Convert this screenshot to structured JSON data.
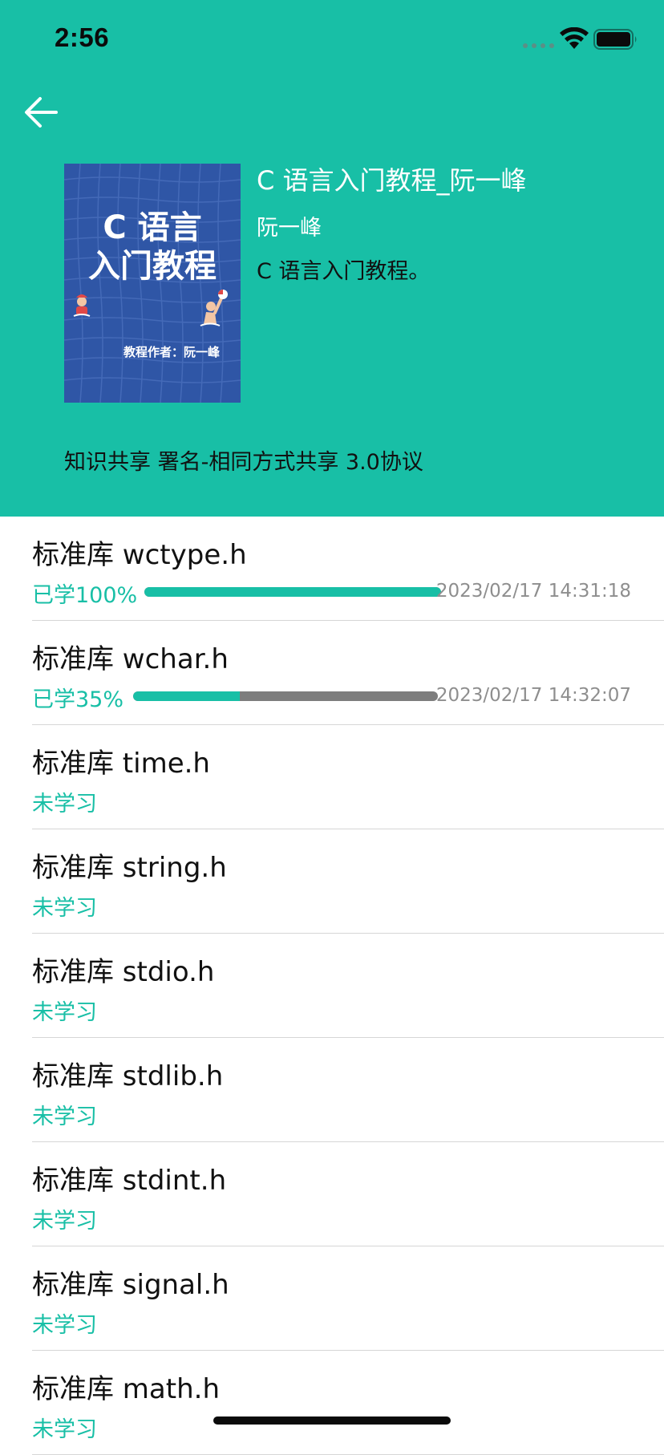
{
  "status_bar": {
    "time": "2:56"
  },
  "book": {
    "cover_title": "C 语言\n入门教程",
    "cover_author": "教程作者：阮一峰",
    "title": "C 语言入门教程_阮一峰",
    "author": "阮一峰",
    "description": "C 语言入门教程。",
    "license": "知识共享 署名-相同方式共享 3.0协议"
  },
  "colors": {
    "accent": "#18bfa6",
    "cover_blue": "#2f56a6",
    "progress_track": "#7d7d7d",
    "timestamp": "#8e8e8e"
  },
  "icons": {
    "back": "arrow-left-icon",
    "signal": "signal-dots-icon",
    "wifi": "wifi-icon",
    "battery": "battery-icon"
  },
  "chapters": [
    {
      "title": "标准库 wctype.h",
      "status": "已学100%",
      "progress": 1.0,
      "time": "2023/02/17 14:31:18"
    },
    {
      "title": "标准库 wchar.h",
      "status": "已学35%",
      "progress": 0.35,
      "time": "2023/02/17 14:32:07"
    },
    {
      "title": "标准库 time.h",
      "status": "未学习"
    },
    {
      "title": "标准库 string.h",
      "status": "未学习"
    },
    {
      "title": "标准库 stdio.h",
      "status": "未学习"
    },
    {
      "title": "标准库 stdlib.h",
      "status": "未学习"
    },
    {
      "title": "标准库 stdint.h",
      "status": "未学习"
    },
    {
      "title": "标准库 signal.h",
      "status": "未学习"
    },
    {
      "title": "标准库 math.h",
      "status": "未学习"
    }
  ]
}
